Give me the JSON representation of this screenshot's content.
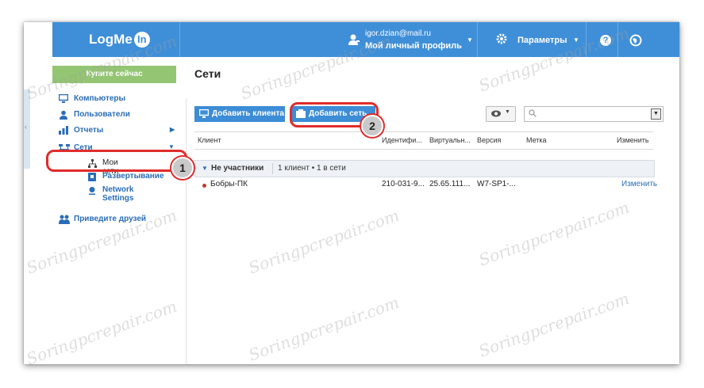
{
  "header": {
    "logo": "LogMe",
    "logo_badge": "In",
    "user_email": "igor.dzian@mail.ru",
    "user_profile": "Мой личный профиль",
    "settings_label": "Параметры",
    "help_label": "?"
  },
  "sidebar": {
    "buy_now": "Купите сейчас",
    "items": [
      {
        "label": "Компьютеры",
        "icon": "monitor-icon"
      },
      {
        "label": "Пользователи",
        "icon": "user-icon"
      },
      {
        "label": "Отчеты",
        "icon": "bar-chart-icon"
      },
      {
        "label": "Сети",
        "icon": "network-icon"
      },
      {
        "label": "Приведите друзей",
        "icon": "friends-icon"
      }
    ],
    "sub_items": [
      {
        "label": "Мои сети",
        "icon": "network-small-icon"
      },
      {
        "label": "Развертывание",
        "icon": "deploy-icon"
      },
      {
        "label": "Network Settings",
        "icon": "settings-dot-icon"
      }
    ]
  },
  "main": {
    "title": "Сети",
    "add_client": "Добавить клиента",
    "add_network": "Добавить сеть",
    "search_placeholder": "",
    "columns": [
      "Клиент",
      "Идентифи...",
      "Виртуальн...",
      "Версия",
      "Метка",
      "Изменить"
    ],
    "group": {
      "name": "Не участники",
      "info": "1 клиент • 1 в сети"
    },
    "rows": [
      {
        "client": "Бобры-ПК",
        "id": "210-031-9...",
        "virtual_ip": "25.65.111...",
        "version": "W7-SP1-...",
        "label": "",
        "action": "Изменить"
      }
    ]
  },
  "callouts": {
    "one": "1",
    "two": "2"
  },
  "watermark": "Soringpcrepair.com",
  "colors": {
    "header": "#3f8fd8",
    "buy": "#93c572",
    "highlight": "#e02c2c"
  }
}
